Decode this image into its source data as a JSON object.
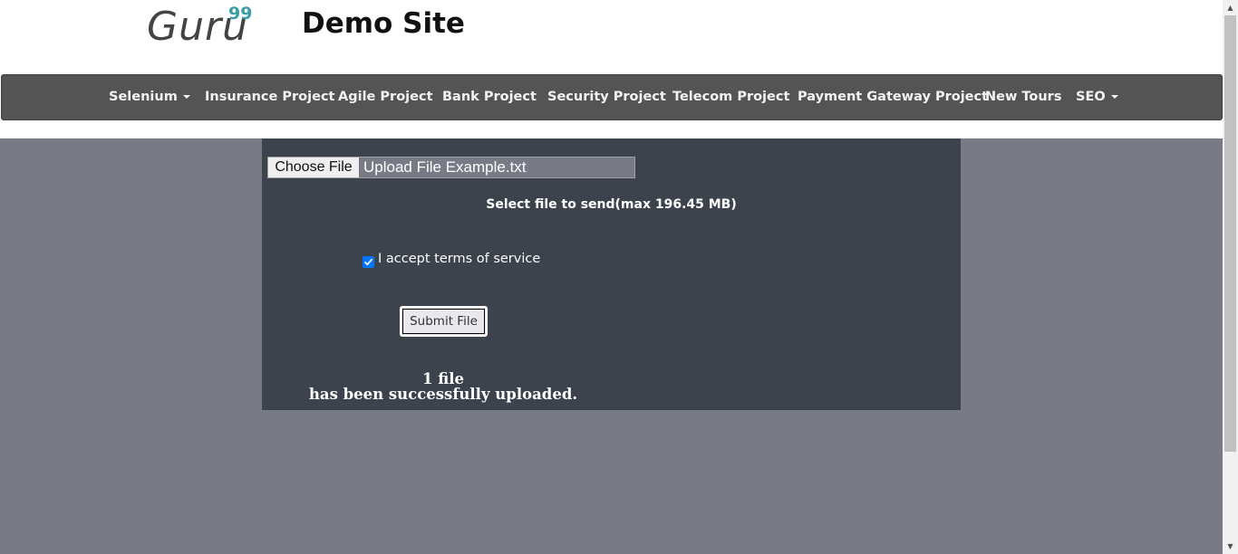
{
  "header": {
    "logo_text": "Guru",
    "logo_sup": "99",
    "site_title": "Demo Site"
  },
  "nav": {
    "items": [
      {
        "label": "Selenium",
        "dropdown": true
      },
      {
        "label": "Insurance Project",
        "dropdown": false
      },
      {
        "label": "Agile Project",
        "dropdown": false
      },
      {
        "label": "Bank Project",
        "dropdown": false
      },
      {
        "label": "Security Project",
        "dropdown": false
      },
      {
        "label": "Telecom Project",
        "dropdown": false
      },
      {
        "label": "Payment Gateway Project",
        "dropdown": false
      },
      {
        "label": "New Tours",
        "dropdown": false
      },
      {
        "label": "SEO",
        "dropdown": true
      }
    ]
  },
  "upload": {
    "choose_label": "Choose File",
    "file_name": "Upload File Example.txt",
    "hint": "Select file to send(max 196.45 MB)",
    "terms_label": "I accept terms of service",
    "terms_checked": true,
    "submit_label": "Submit File",
    "result_line1": "1 file",
    "result_line2": "has been successfully uploaded."
  },
  "colors": {
    "accent": "#3a9ea7",
    "navbar": "#545454",
    "panel": "#3d434d",
    "page_bg": "#787b85",
    "checkbox": "#0075ff"
  }
}
